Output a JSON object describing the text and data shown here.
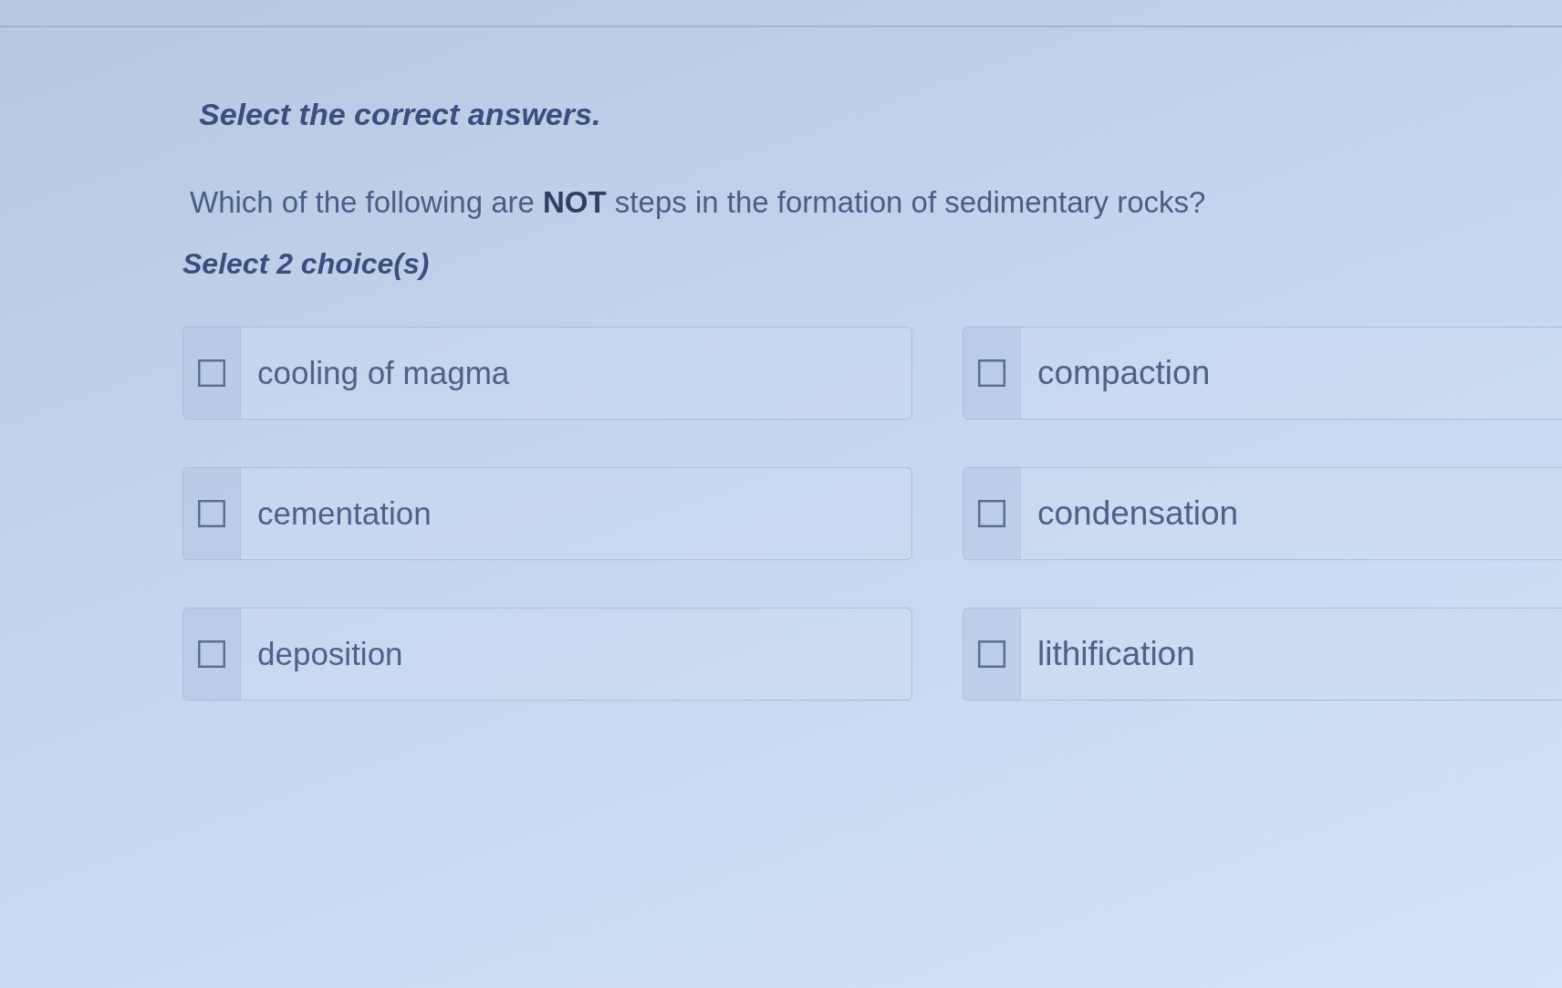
{
  "instructions": "Select the correct answers.",
  "question": "Which of the following are **NOT** steps in the formation of sedimentary rocks?",
  "hint": "Select 2 choice(s)",
  "choices": [
    {
      "label": "cooling of magma",
      "checked": false
    },
    {
      "label": "compaction",
      "checked": false
    },
    {
      "label": "cementation",
      "checked": false
    },
    {
      "label": "condensation",
      "checked": false
    },
    {
      "label": "deposition",
      "checked": false
    },
    {
      "label": "lithification",
      "checked": false
    }
  ]
}
